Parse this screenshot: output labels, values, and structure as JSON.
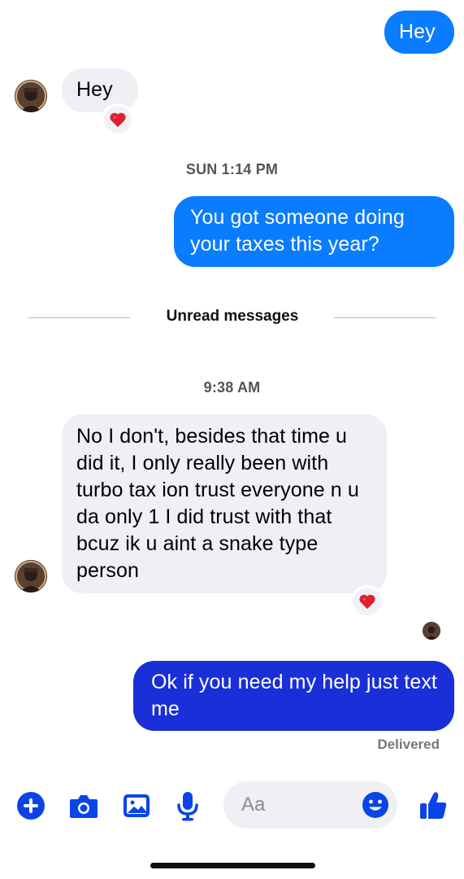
{
  "messages": [
    {
      "dir": "out",
      "text": "Hey"
    },
    {
      "dir": "in",
      "text": "Hey",
      "reaction": "heart"
    },
    {
      "dir": "out",
      "text": "You got someone doing your taxes this year?"
    },
    {
      "dir": "in",
      "text": "No I don't, besides that time u did it, I only really been with turbo tax ion trust everyone n u da only 1 I did trust with that bcuz ik u aint a snake type person",
      "reaction": "heart"
    },
    {
      "dir": "out",
      "text": "Ok if you need my help just text me"
    }
  ],
  "timestamps": {
    "first": "SUN 1:14 PM",
    "second": "9:38 AM"
  },
  "unread_label": "Unread messages",
  "status": {
    "delivered": "Delivered"
  },
  "composer": {
    "placeholder": "Aa"
  },
  "colors": {
    "outgoing_bubble": "#0a7cff",
    "outgoing_bubble_latest": "#1a2fd8",
    "incoming_bubble": "#efeff4",
    "toolbar_icon": "#0a44e8",
    "reaction": "#e0202e"
  },
  "toolbar_icons": [
    "plus-icon",
    "camera-icon",
    "image-icon",
    "microphone-icon",
    "emoji-icon",
    "thumbs-up-icon"
  ]
}
